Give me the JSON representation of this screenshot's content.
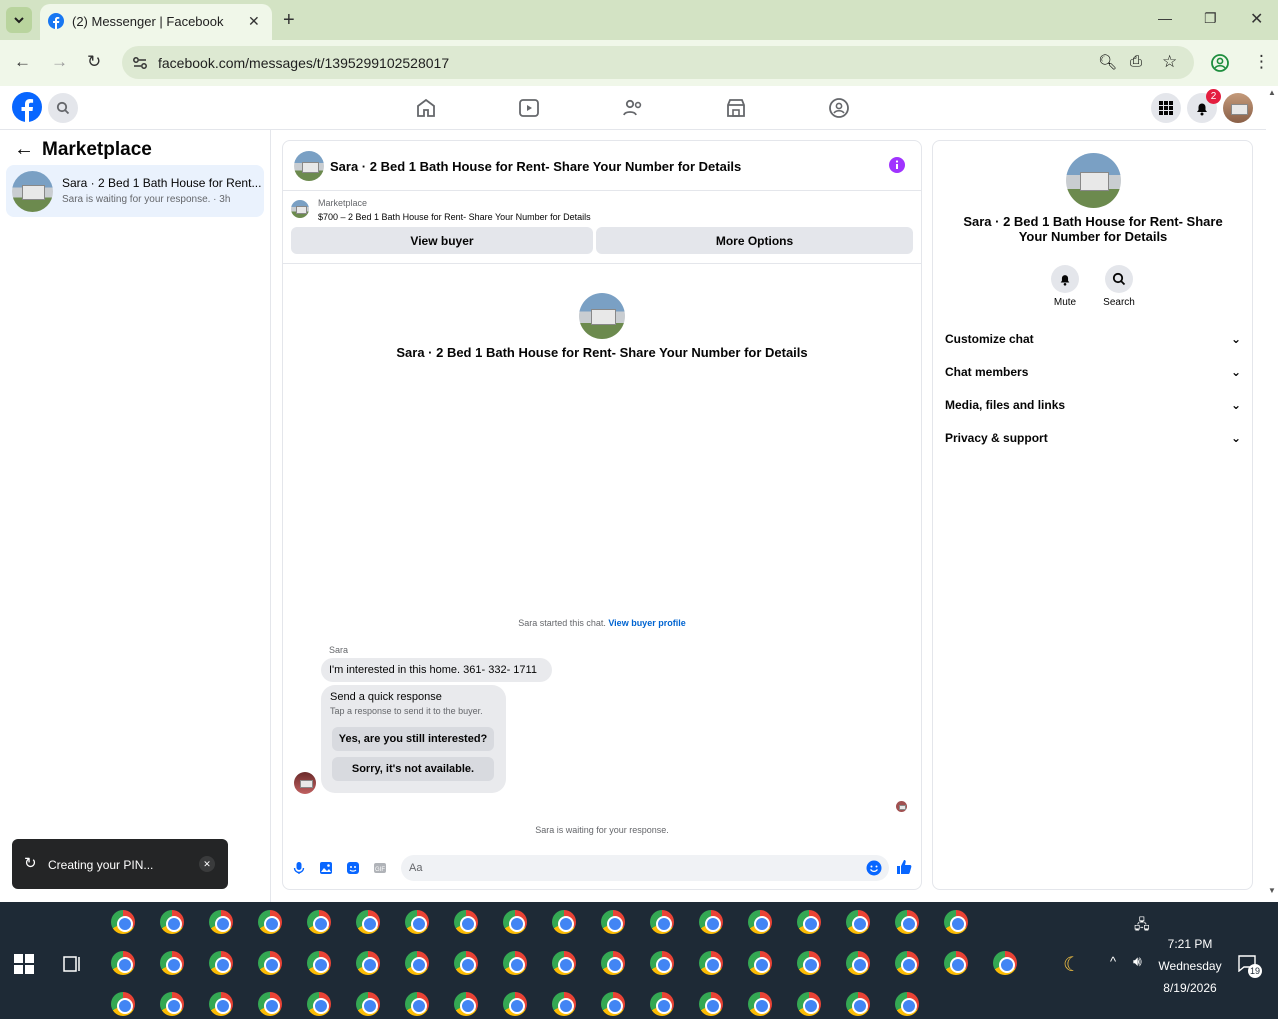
{
  "browser": {
    "tab_title": "(2) Messenger | Facebook",
    "url": "facebook.com/messages/t/1395299102528017"
  },
  "header": {
    "notification_count": "2"
  },
  "left": {
    "title": "Marketplace",
    "item_title": "Sara · 2 Bed 1 Bath House for Rent...",
    "item_sub": "Sara is waiting for your response. · 3h"
  },
  "chat": {
    "title": "Sara · 2 Bed 1 Bath House for Rent- Share Your Number for Details",
    "mp_label": "Marketplace",
    "mp_listing": "$700 – 2 Bed 1 Bath House for Rent- Share Your Number for Details",
    "view_buyer": "View buyer",
    "more_options": "More Options",
    "profile_name": "Sara · 2 Bed 1 Bath House for Rent- Share Your Number for Details",
    "started_text": "Sara started this chat.",
    "view_buyer_profile": "View buyer profile",
    "sender": "Sara",
    "message": "I'm interested in this home. 361- 332- 1711",
    "quick_title": "Send a quick response",
    "quick_sub": "Tap a response to send it to the buyer.",
    "quick_1": "Yes, are you still interested?",
    "quick_2": "Sorry, it's not available.",
    "waiting": "Sara is waiting for your response.",
    "input_placeholder": "Aa"
  },
  "right": {
    "name": "Sara · 2 Bed 1 Bath House for Rent- Share Your Number for Details",
    "mute": "Mute",
    "search": "Search",
    "sections": [
      "Customize chat",
      "Chat members",
      "Media, files and links",
      "Privacy & support"
    ]
  },
  "toast": {
    "text": "Creating your PIN..."
  },
  "clock": {
    "time": "7:21 PM",
    "day": "Wednesday",
    "date": "8/19/2026",
    "notif": "19"
  }
}
